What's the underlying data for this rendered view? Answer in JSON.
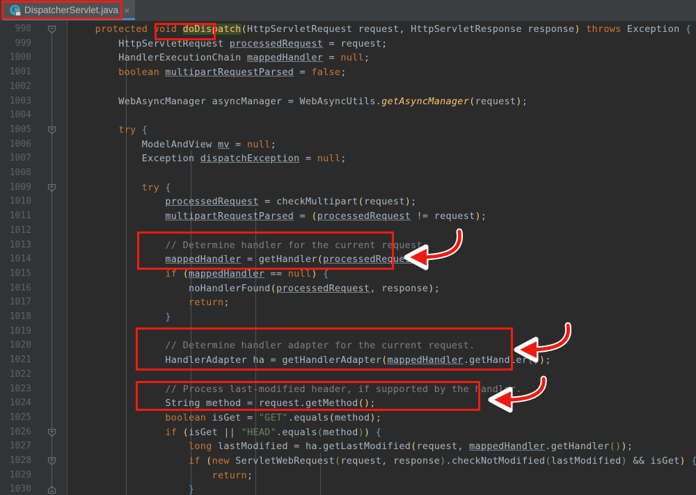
{
  "window": {
    "app": "IntelliJ IDEA code editor",
    "theme_bg": "#2b2b2b",
    "accent": "#4a88c7",
    "annotation_color": "#f41b10"
  },
  "tab": {
    "label": "DispatcherServlet.java",
    "icon": "java-class-icon",
    "close_label": "×",
    "active": true
  },
  "editor": {
    "first_line": 998,
    "last_line": 1030,
    "highlighted_symbol": "doDispatch",
    "line_numbers": [
      998,
      999,
      1000,
      1001,
      1002,
      1003,
      1004,
      1005,
      1006,
      1007,
      1008,
      1009,
      1010,
      1011,
      1012,
      1013,
      1014,
      1015,
      1016,
      1017,
      1018,
      1019,
      1020,
      1021,
      1022,
      1023,
      1024,
      1025,
      1026,
      1027,
      1028,
      1029,
      1030
    ],
    "lines": [
      {
        "n": 998,
        "text": "    protected void doDispatch(HttpServletRequest request, HttpServletResponse response) throws Exception {"
      },
      {
        "n": 999,
        "text": "        HttpServletRequest processedRequest = request;"
      },
      {
        "n": 1000,
        "text": "        HandlerExecutionChain mappedHandler = null;"
      },
      {
        "n": 1001,
        "text": "        boolean multipartRequestParsed = false;"
      },
      {
        "n": 1002,
        "text": ""
      },
      {
        "n": 1003,
        "text": "        WebAsyncManager asyncManager = WebAsyncUtils.getAsyncManager(request);"
      },
      {
        "n": 1004,
        "text": ""
      },
      {
        "n": 1005,
        "text": "        try {"
      },
      {
        "n": 1006,
        "text": "            ModelAndView mv = null;"
      },
      {
        "n": 1007,
        "text": "            Exception dispatchException = null;"
      },
      {
        "n": 1008,
        "text": ""
      },
      {
        "n": 1009,
        "text": "            try {"
      },
      {
        "n": 1010,
        "text": "                processedRequest = checkMultipart(request);"
      },
      {
        "n": 1011,
        "text": "                multipartRequestParsed = (processedRequest != request);"
      },
      {
        "n": 1012,
        "text": ""
      },
      {
        "n": 1013,
        "text": "                // Determine handler for the current request."
      },
      {
        "n": 1014,
        "text": "                mappedHandler = getHandler(processedRequest);"
      },
      {
        "n": 1015,
        "text": "                if (mappedHandler == null) {"
      },
      {
        "n": 1016,
        "text": "                    noHandlerFound(processedRequest, response);"
      },
      {
        "n": 1017,
        "text": "                    return;"
      },
      {
        "n": 1018,
        "text": "                }"
      },
      {
        "n": 1019,
        "text": ""
      },
      {
        "n": 1020,
        "text": "                // Determine handler adapter for the current request."
      },
      {
        "n": 1021,
        "text": "                HandlerAdapter ha = getHandlerAdapter(mappedHandler.getHandler());"
      },
      {
        "n": 1022,
        "text": ""
      },
      {
        "n": 1023,
        "text": "                // Process last-modified header, if supported by the handler."
      },
      {
        "n": 1024,
        "text": "                String method = request.getMethod();"
      },
      {
        "n": 1025,
        "text": "                boolean isGet = \"GET\".equals(method);"
      },
      {
        "n": 1026,
        "text": "                if (isGet || \"HEAD\".equals(method)) {"
      },
      {
        "n": 1027,
        "text": "                    long lastModified = ha.getLastModified(request, mappedHandler.getHandler());"
      },
      {
        "n": 1028,
        "text": "                    if (new ServletWebRequest(request, response).checkNotModified(lastModified) && isGet) {"
      },
      {
        "n": 1029,
        "text": "                        return;"
      },
      {
        "n": 1030,
        "text": "                    }"
      }
    ]
  },
  "annotations": {
    "boxes": [
      {
        "name": "highlight-box-tab",
        "target": "DispatcherServlet.java"
      },
      {
        "name": "highlight-box-method",
        "target": "doDispatch"
      },
      {
        "name": "highlight-box-handler",
        "target": "// Determine handler for the current request. / mappedHandler = getHandler(processedRequest);"
      },
      {
        "name": "highlight-box-adapter",
        "target": "// Determine handler adapter for the current request. / HandlerAdapter ha = getHandlerAdapter(mappedHandler.getHandler());"
      },
      {
        "name": "highlight-box-lastmod",
        "target": "// Process last-modified header, if supported by the handler. / String method = request.getMethod();"
      }
    ],
    "arrows": [
      {
        "name": "arrow-handler",
        "points_to": "highlight-box-handler"
      },
      {
        "name": "arrow-adapter",
        "points_to": "highlight-box-adapter"
      },
      {
        "name": "arrow-lastmod",
        "points_to": "highlight-box-lastmod"
      }
    ]
  }
}
